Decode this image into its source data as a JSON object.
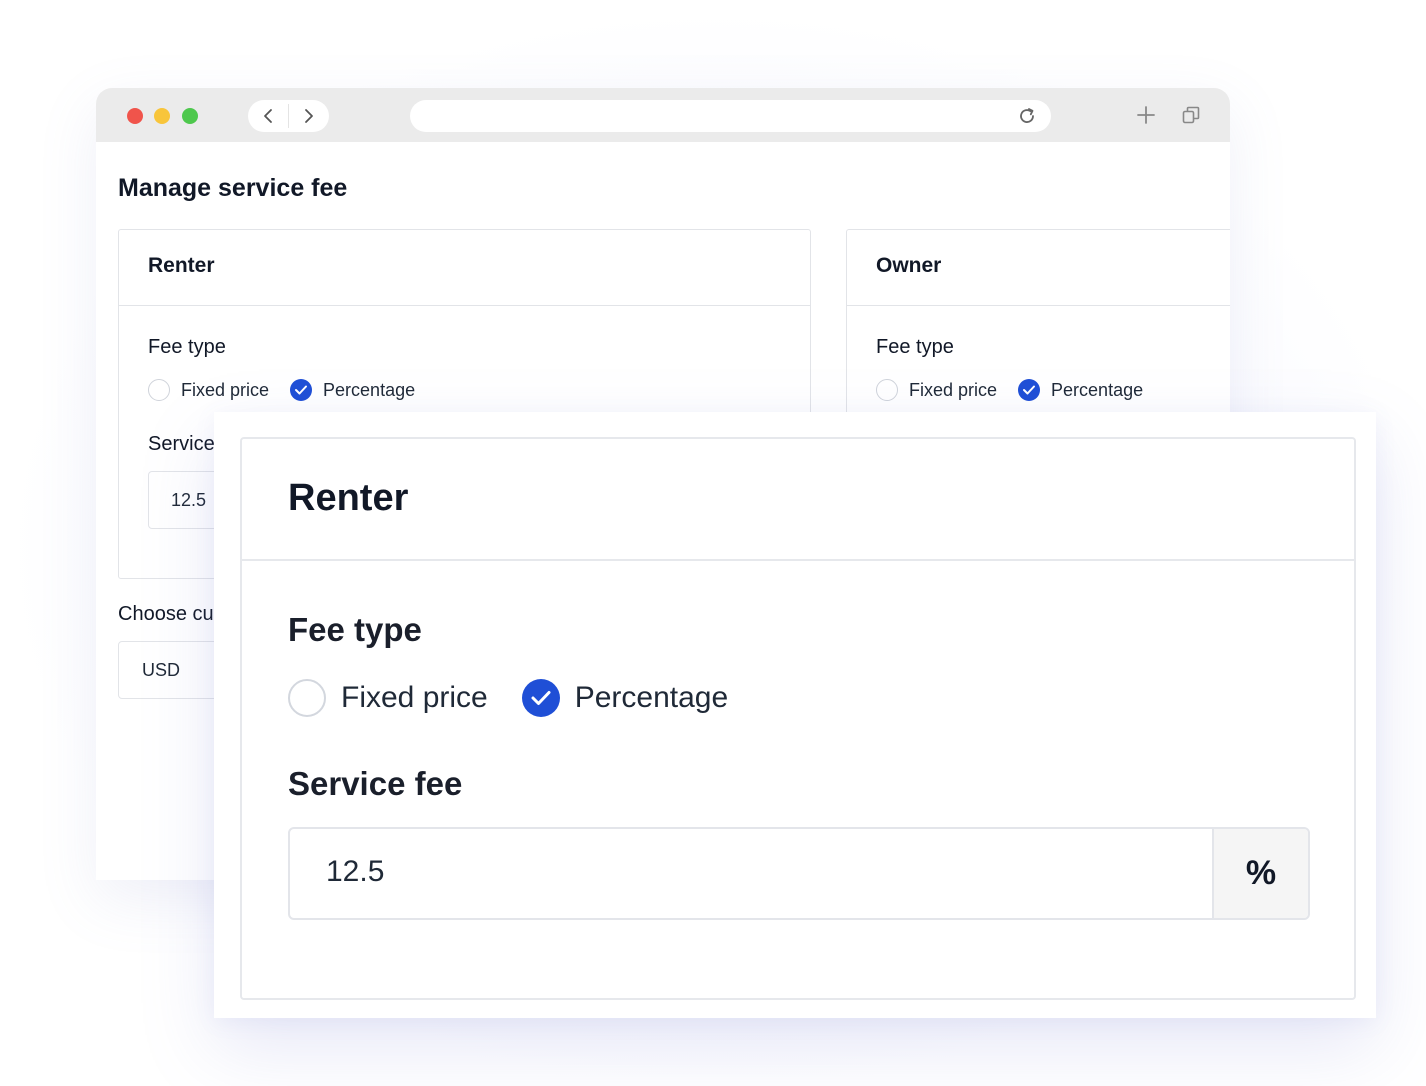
{
  "page": {
    "title": "Manage service fee"
  },
  "renter_card": {
    "title": "Renter",
    "fee_type_label": "Fee type",
    "options": [
      {
        "label": "Fixed price",
        "checked": false
      },
      {
        "label": "Percentage",
        "checked": true
      }
    ],
    "service_fee_label": "Service",
    "service_fee_value": "12.5"
  },
  "owner_card": {
    "title": "Owner",
    "fee_type_label": "Fee type",
    "options": [
      {
        "label": "Fixed price",
        "checked": false
      },
      {
        "label": "Percentage",
        "checked": true
      }
    ]
  },
  "currency": {
    "label": "Choose cu",
    "value": "USD"
  },
  "zoom": {
    "title": "Renter",
    "fee_type_label": "Fee type",
    "options": [
      {
        "label": "Fixed price",
        "checked": false
      },
      {
        "label": "Percentage",
        "checked": true
      }
    ],
    "service_fee_label": "Service fee",
    "service_fee_value": "12.5",
    "unit": "%"
  },
  "colors": {
    "accent": "#1f4fd6",
    "chrome": "#ebebeb",
    "close": "#f0544b",
    "minimize": "#f8c53b",
    "maximize": "#4ec84d"
  },
  "icons": [
    "back-arrow-icon",
    "forward-arrow-icon",
    "reload-icon",
    "plus-icon",
    "tabs-icon",
    "check-icon"
  ]
}
